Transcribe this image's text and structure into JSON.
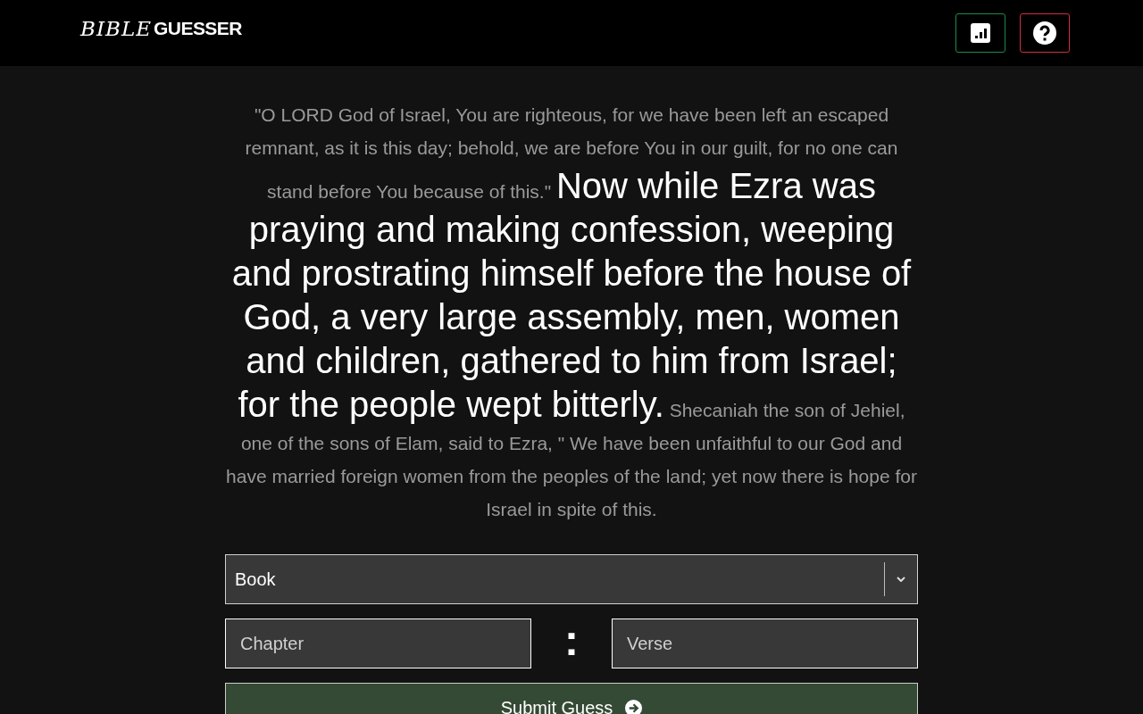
{
  "header": {
    "logo": {
      "part_1": "BIBLE",
      "part_2": "GUESSER"
    }
  },
  "passage": {
    "before": "\"O LORD God of Israel, You are righteous, for we have been left an escaped remnant, as it is this day; behold, we are before You in our guilt, for no one can stand before You because of this.\"",
    "verse": "Now while Ezra was praying and making confession, weeping and prostrating himself before the house of God, a very large assembly, men, women and children, gathered to him from Israel; for the people wept bitterly.",
    "after": "Shecaniah the son of Jehiel, one of the sons of Elam, said to Ezra, \" We have been unfaithful to our God and have married foreign women from the peoples of the land; yet now there is hope for Israel in spite of this."
  },
  "form": {
    "book": {
      "value": "Book"
    },
    "chapter": {
      "placeholder": "Chapter"
    },
    "separator": ":",
    "verse": {
      "placeholder": "Verse"
    },
    "submit": "Submit Guess"
  }
}
